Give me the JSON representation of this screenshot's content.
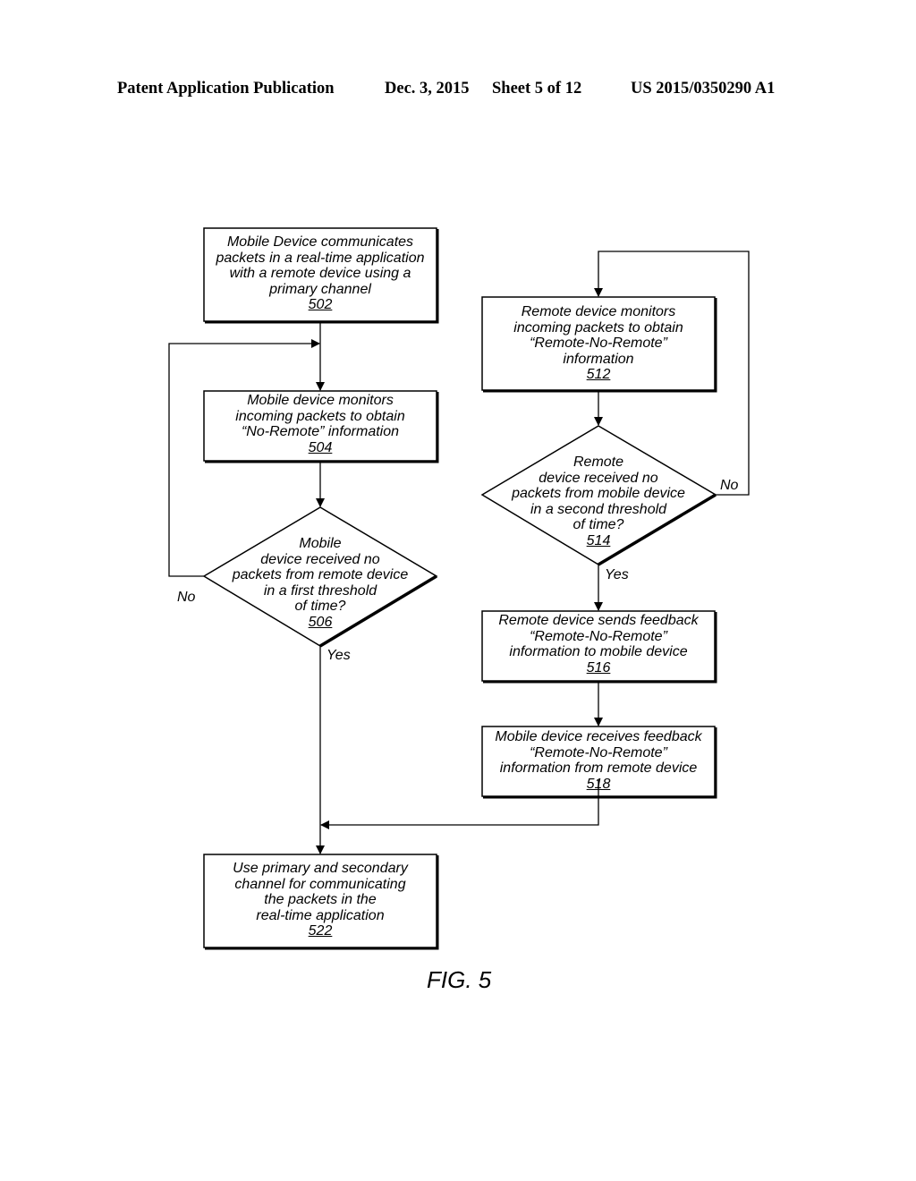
{
  "header": {
    "publication": "Patent Application Publication",
    "date": "Dec. 3, 2015",
    "sheet": "Sheet 5 of 12",
    "patent_number": "US 2015/0350290 A1"
  },
  "nodes": {
    "n502": {
      "lines": [
        "Mobile Device communicates",
        "packets in a real-time application",
        "with a remote device using a",
        "primary channel"
      ],
      "ref": "502"
    },
    "n504": {
      "lines": [
        "Mobile device monitors",
        "incoming packets to obtain",
        "“No-Remote” information"
      ],
      "ref": "504"
    },
    "n506": {
      "lines": [
        "Mobile",
        "device received no",
        "packets from remote device",
        "in a first threshold",
        "of time?"
      ],
      "ref": "506"
    },
    "n512": {
      "lines": [
        "Remote device monitors",
        "incoming packets to obtain",
        "“Remote-No-Remote”",
        "information"
      ],
      "ref": "512"
    },
    "n514": {
      "lines": [
        "Remote",
        "device received no",
        "packets from mobile device",
        "in a second threshold",
        "of time?"
      ],
      "ref": "514"
    },
    "n516": {
      "lines": [
        "Remote device sends feedback",
        "“Remote-No-Remote”",
        "information to mobile device"
      ],
      "ref": "516"
    },
    "n518": {
      "lines": [
        "Mobile device receives feedback",
        "“Remote-No-Remote”",
        "information from remote device"
      ],
      "ref": "518"
    },
    "n522": {
      "lines": [
        "Use primary and secondary",
        "channel for communicating",
        "the packets in the",
        "real-time application"
      ],
      "ref": "522"
    }
  },
  "edge_labels": {
    "n506_no": "No",
    "n506_yes": "Yes",
    "n514_no": "No",
    "n514_yes": "Yes"
  },
  "figure_label": "FIG. 5"
}
